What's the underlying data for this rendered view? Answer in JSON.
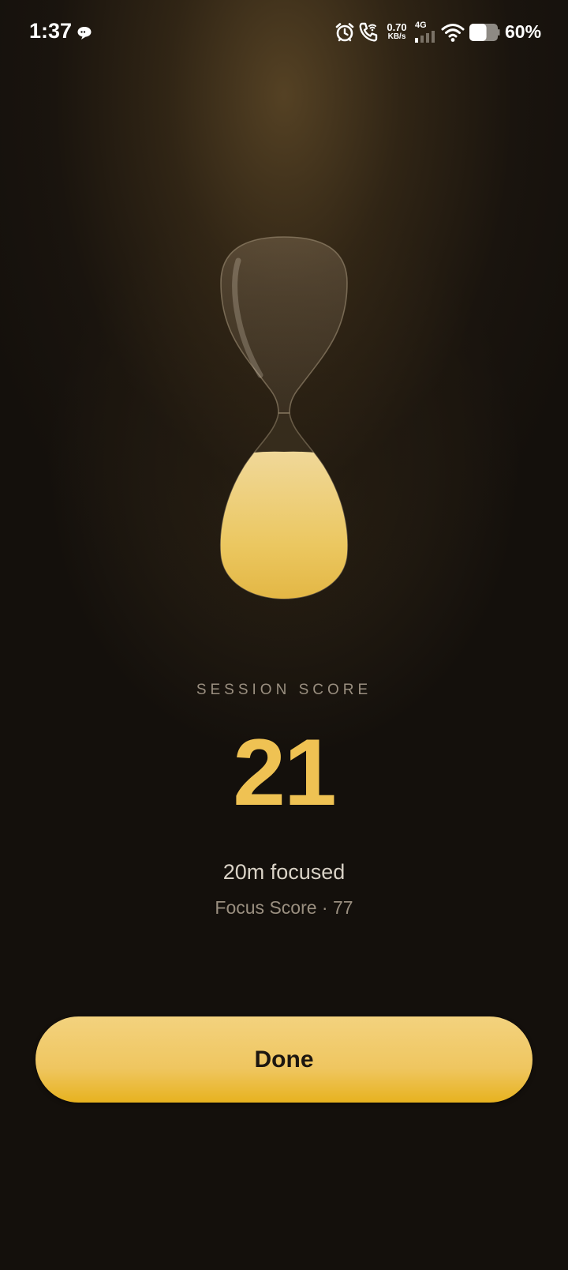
{
  "status_bar": {
    "time": "1:37",
    "net_speed_value": "0.70",
    "net_speed_unit": "KB/s",
    "network_type": "4G",
    "battery_percent": "60%",
    "icons": [
      "chat-bubble-icon",
      "alarm-icon",
      "wifi-calling-icon",
      "signal-icon",
      "wifi-icon",
      "battery-icon"
    ],
    "battery_level": 0.6
  },
  "hourglass": {
    "icon": "hourglass-icon",
    "fill_level": 1.0,
    "sand_color": "#efc253"
  },
  "session": {
    "label": "SESSION SCORE",
    "score": "21",
    "focused_text": "20m focused",
    "focus_score_text": "Focus Score · 77"
  },
  "actions": {
    "done_label": "Done"
  },
  "colors": {
    "accent": "#efc253",
    "background": "#14100c",
    "muted_text": "#9a8f80"
  }
}
